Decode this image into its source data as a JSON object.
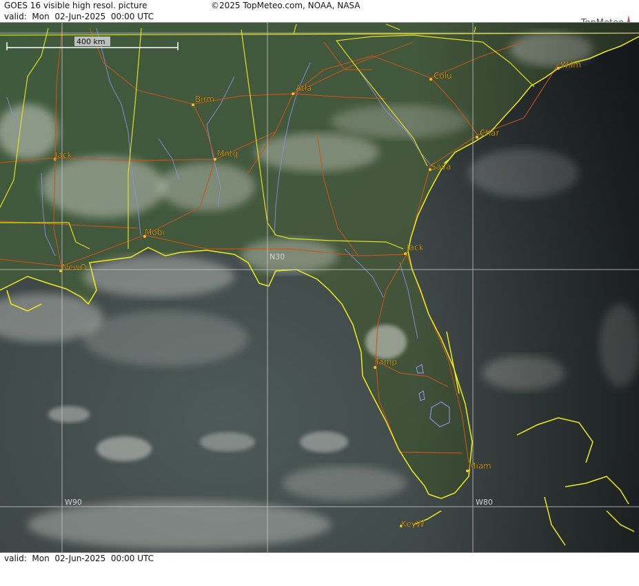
{
  "header": {
    "title": "GOES 16 visible high resol. picture",
    "copyright": "©2025 TopMeteo.com, NOAA, NASA",
    "valid": "valid:  Mon  02-Jun-2025  00:00 UTC",
    "logo": "TopMeteo"
  },
  "footer": {
    "valid": "valid:  Mon  02-Jun-2025  00:00 UTC"
  },
  "scale": {
    "label": "400 km"
  },
  "grid": {
    "lat_label": "N30",
    "lon_west_label": "W90",
    "lon_east_label": "W80"
  },
  "cities": [
    {
      "key": "wilm",
      "name": "Wilm"
    },
    {
      "key": "colu",
      "name": "Colu"
    },
    {
      "key": "atla",
      "name": "Atla"
    },
    {
      "key": "birm",
      "name": "Birm"
    },
    {
      "key": "char",
      "name": "Char"
    },
    {
      "key": "jack_ms",
      "name": "Jack"
    },
    {
      "key": "mntg",
      "name": "Mntg"
    },
    {
      "key": "sava",
      "name": "Sava"
    },
    {
      "key": "mobi",
      "name": "Mobi"
    },
    {
      "key": "jack_fl",
      "name": "Jack"
    },
    {
      "key": "newo",
      "name": "NewO"
    },
    {
      "key": "tamp",
      "name": "Tamp"
    },
    {
      "key": "miam",
      "name": "Miam"
    },
    {
      "key": "keyw",
      "name": "KeyW"
    }
  ],
  "colors": {
    "coast": "#f2ee1a",
    "border": "#e6e020",
    "road": "#c8551a",
    "river": "#8c8ee6",
    "city": "#ffbf1a",
    "grid": "#c8c8c8"
  }
}
